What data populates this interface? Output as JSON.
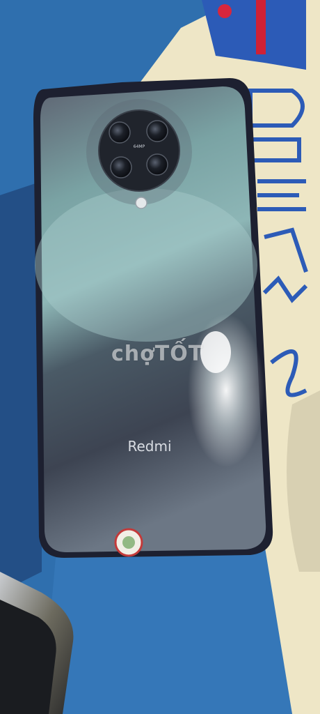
{
  "scene": {
    "description_colors": {
      "fabric_blue": "#2f6fae",
      "fabric_cream": "#eee6c6",
      "phone_case": "#1f2230",
      "phone_back_teal": "#7fa7a8",
      "phone_back_dark": "#3a4250"
    }
  },
  "phone": {
    "brand_text": "Redmi",
    "camera_label": "64MP"
  },
  "watermark": {
    "text": "chợTỐT"
  }
}
